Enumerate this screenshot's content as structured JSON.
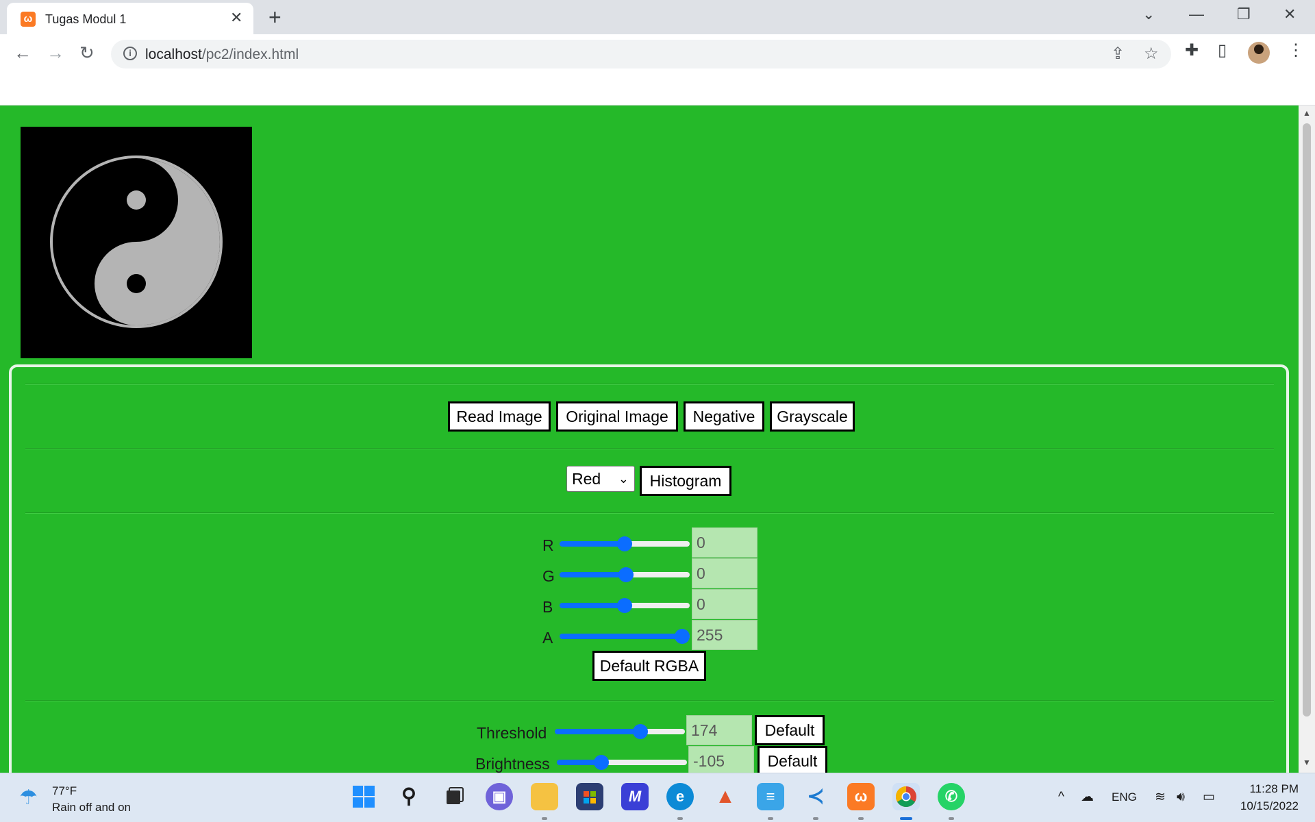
{
  "browser": {
    "tab": {
      "favicon": "xampp-icon",
      "title": "Tugas Modul 1",
      "close": "✕"
    },
    "new_tab": "+",
    "window_controls": {
      "tab_search": "⌄",
      "minimize": "—",
      "restore": "❐",
      "close": "✕"
    },
    "url": {
      "host": "localhost",
      "path": "/pc2/index.html"
    },
    "icons": [
      "back-icon",
      "forward-icon",
      "reload-icon",
      "info-icon",
      "share-icon",
      "star-icon",
      "extensions-icon",
      "side-panel-icon",
      "profile-avatar",
      "menu-icon"
    ]
  },
  "page": {
    "background_color": "#25b929",
    "image_canvas": {
      "description_icon": "yin-yang-image"
    },
    "buttons": {
      "read_image": "Read Image",
      "original_image": "Original Image",
      "negative": "Negative",
      "grayscale": "Grayscale",
      "histogram": "Histogram",
      "default_rgba": "Default RGBA",
      "threshold_default": "Default",
      "brightness_default": "Default"
    },
    "channel_select": {
      "selected": "Red"
    },
    "rgba": {
      "r": {
        "label": "R",
        "value": "0",
        "slider_fraction": 0.5
      },
      "g": {
        "label": "G",
        "value": "0",
        "slider_fraction": 0.51
      },
      "b": {
        "label": "B",
        "value": "0",
        "slider_fraction": 0.5
      },
      "a": {
        "label": "A",
        "value": "255",
        "slider_fraction": 1.0
      }
    },
    "threshold": {
      "label": "Threshold",
      "value": "174",
      "slider_fraction": 0.68
    },
    "brightness": {
      "label": "Brightness",
      "value": "-105",
      "slider_fraction": 0.32
    }
  },
  "taskbar": {
    "weather": {
      "temp": "77°F",
      "condition": "Rain off and on"
    },
    "apps": [
      "start-icon",
      "search-icon",
      "task-view-icon",
      "teams-chat-icon",
      "file-explorer-icon",
      "store-icon",
      "mathcad-icon",
      "edge-icon",
      "matlab-icon",
      "notepad-icon",
      "vscode-icon",
      "xampp-icon",
      "chrome-icon",
      "whatsapp-icon"
    ],
    "tray": {
      "chevron": "^",
      "language": "ENG"
    },
    "clock": {
      "time": "11:28 PM",
      "date": "10/15/2022"
    }
  }
}
